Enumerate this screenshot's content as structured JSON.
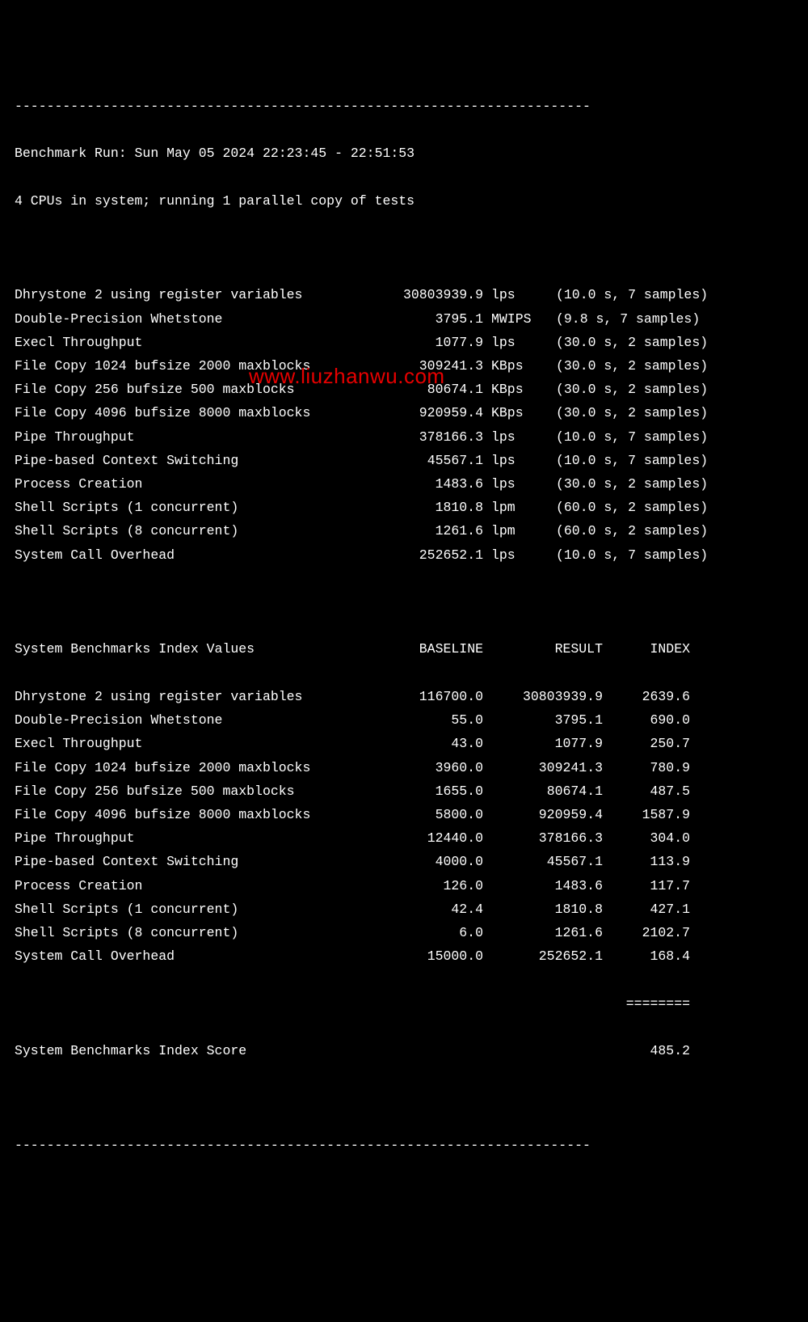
{
  "separator": "------------------------------------------------------------------------",
  "separator_bottom": "------------------------------------------------------------------------",
  "header": {
    "run_line": "Benchmark Run: Sun May 05 2024 22:23:45 - 22:51:53",
    "cpu_line": "4 CPUs in system; running 1 parallel copy of tests"
  },
  "tests": [
    {
      "name": "Dhrystone 2 using register variables",
      "value": "30803939.9",
      "unit": "lps",
      "time": "(10.0 s, 7 samples)"
    },
    {
      "name": "Double-Precision Whetstone",
      "value": "3795.1",
      "unit": "MWIPS",
      "time": "(9.8 s, 7 samples)"
    },
    {
      "name": "Execl Throughput",
      "value": "1077.9",
      "unit": "lps",
      "time": "(30.0 s, 2 samples)"
    },
    {
      "name": "File Copy 1024 bufsize 2000 maxblocks",
      "value": "309241.3",
      "unit": "KBps",
      "time": "(30.0 s, 2 samples)"
    },
    {
      "name": "File Copy 256 bufsize 500 maxblocks",
      "value": "80674.1",
      "unit": "KBps",
      "time": "(30.0 s, 2 samples)"
    },
    {
      "name": "File Copy 4096 bufsize 8000 maxblocks",
      "value": "920959.4",
      "unit": "KBps",
      "time": "(30.0 s, 2 samples)"
    },
    {
      "name": "Pipe Throughput",
      "value": "378166.3",
      "unit": "lps",
      "time": "(10.0 s, 7 samples)"
    },
    {
      "name": "Pipe-based Context Switching",
      "value": "45567.1",
      "unit": "lps",
      "time": "(10.0 s, 7 samples)"
    },
    {
      "name": "Process Creation",
      "value": "1483.6",
      "unit": "lps",
      "time": "(30.0 s, 2 samples)"
    },
    {
      "name": "Shell Scripts (1 concurrent)",
      "value": "1810.8",
      "unit": "lpm",
      "time": "(60.0 s, 2 samples)"
    },
    {
      "name": "Shell Scripts (8 concurrent)",
      "value": "1261.6",
      "unit": "lpm",
      "time": "(60.0 s, 2 samples)"
    },
    {
      "name": "System Call Overhead",
      "value": "252652.1",
      "unit": "lps",
      "time": "(10.0 s, 7 samples)"
    }
  ],
  "index_header": {
    "name": "System Benchmarks Index Values",
    "baseline": "BASELINE",
    "result": "RESULT",
    "index": "INDEX"
  },
  "index": [
    {
      "name": "Dhrystone 2 using register variables",
      "baseline": "116700.0",
      "result": "30803939.9",
      "index": "2639.6"
    },
    {
      "name": "Double-Precision Whetstone",
      "baseline": "55.0",
      "result": "3795.1",
      "index": "690.0"
    },
    {
      "name": "Execl Throughput",
      "baseline": "43.0",
      "result": "1077.9",
      "index": "250.7"
    },
    {
      "name": "File Copy 1024 bufsize 2000 maxblocks",
      "baseline": "3960.0",
      "result": "309241.3",
      "index": "780.9"
    },
    {
      "name": "File Copy 256 bufsize 500 maxblocks",
      "baseline": "1655.0",
      "result": "80674.1",
      "index": "487.5"
    },
    {
      "name": "File Copy 4096 bufsize 8000 maxblocks",
      "baseline": "5800.0",
      "result": "920959.4",
      "index": "1587.9"
    },
    {
      "name": "Pipe Throughput",
      "baseline": "12440.0",
      "result": "378166.3",
      "index": "304.0"
    },
    {
      "name": "Pipe-based Context Switching",
      "baseline": "4000.0",
      "result": "45567.1",
      "index": "113.9"
    },
    {
      "name": "Process Creation",
      "baseline": "126.0",
      "result": "1483.6",
      "index": "117.7"
    },
    {
      "name": "Shell Scripts (1 concurrent)",
      "baseline": "42.4",
      "result": "1810.8",
      "index": "427.1"
    },
    {
      "name": "Shell Scripts (8 concurrent)",
      "baseline": "6.0",
      "result": "1261.6",
      "index": "2102.7"
    },
    {
      "name": "System Call Overhead",
      "baseline": "15000.0",
      "result": "252652.1",
      "index": "168.4"
    }
  ],
  "eqline": "========",
  "score": {
    "label": "System Benchmarks Index Score",
    "value": "485.2"
  },
  "watermark": "www.liuzhanwu.com"
}
